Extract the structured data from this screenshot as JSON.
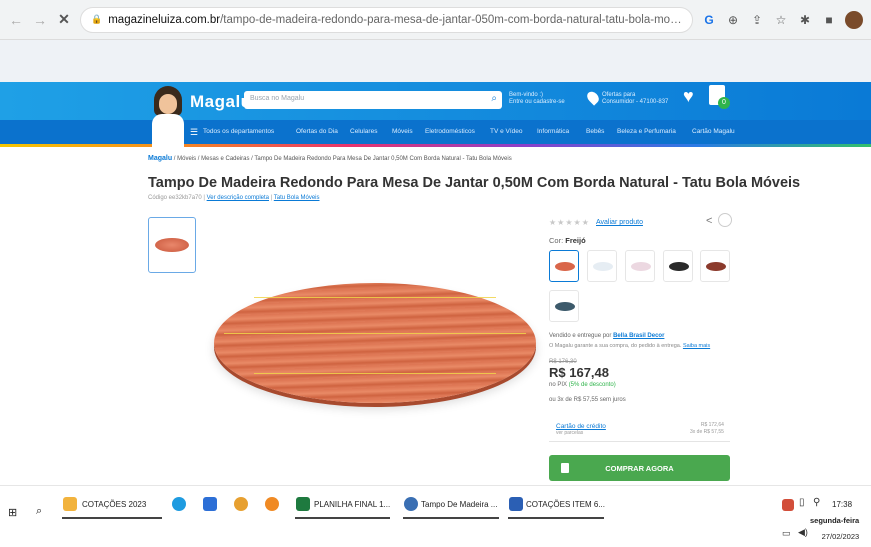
{
  "browser": {
    "url_host": "magazineluiza.com.br",
    "url_path": "/tampo-de-madeira-redondo-para-mesa-de-jantar-050m-com-borda-natural-tatu-bola-moveis/p/ee32kb7a70/mo/przm/?&sell..."
  },
  "site": {
    "logo": "Magalu",
    "search_placeholder": "Busca no Magalu",
    "login_line1": "Bem-vindo :)",
    "login_line2": "Entre ou cadastre-se",
    "location_line1": "Ofertas para",
    "location_line2": "Consumidor - 47100-837",
    "cart_count": "0",
    "nav": {
      "departments": "Todos os departamentos",
      "offers": "Ofertas do Dia",
      "phones": "Celulares",
      "furniture": "Móveis",
      "appliances": "Eletrodomésticos",
      "tv": "TV e Vídeo",
      "computing": "Informática",
      "tools": "Bebês",
      "beauty": "Beleza e Perfumaria",
      "card": "Cartão Magalu"
    }
  },
  "breadcrumb": {
    "home": "Magalu",
    "path": "/ Móveis / Mesas e Cadeiras / Tampo De Madeira Redondo Para Mesa De Jantar 0,50M Com Borda Natural - Tatu Bola Móveis"
  },
  "product": {
    "title": "Tampo De Madeira Redondo Para Mesa De Jantar 0,50M Com Borda Natural - Tatu Bola Móveis",
    "code_prefix": "Código ee32kb7a70 |",
    "code_link": "Ver descrição completa",
    "code_sep": "|",
    "brand_link": "Tatu Bola Móveis",
    "rate_link": "Avaliar produto",
    "color_label": "Cor:",
    "color_value": "Freijó",
    "sold_by_text": "Vendido e entregue por",
    "seller": "Bella Brasil Decor",
    "guarantee_text": "O Magalu garante a sua compra, do pedido à entrega.",
    "guarantee_link": "Saiba mais",
    "old_price": "R$ 176,30",
    "price": "R$ 167,48",
    "pix_text": "no PIX",
    "pix_discount": "(5% de desconto)",
    "installments": "ou 3x de R$ 57,55 sem juros",
    "card_label": "Cartão de crédito",
    "card_sub": "ver parcelas",
    "card_val1": "R$ 172,64",
    "card_val2": "3x de R$ 57,55",
    "buy_label": "COMPRAR AGORA"
  },
  "colors": {
    "wood": "#dd7452",
    "accent": "#0a7ad6",
    "buy": "#4aa84f"
  },
  "taskbar": {
    "items": [
      "COTAÇÕES 2023",
      "PLANILHA FINAL 1...",
      "Tampo De Madeira ...",
      "COTAÇÕES ITEM 6..."
    ],
    "time": "17:38",
    "weekday": "segunda-feira",
    "date": "27/02/2023"
  }
}
